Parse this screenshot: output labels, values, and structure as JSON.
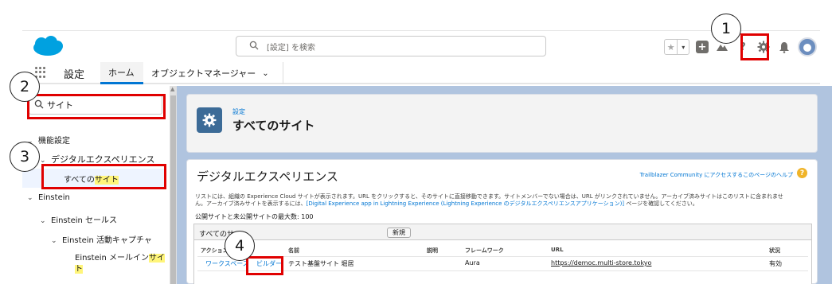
{
  "header": {
    "search_placeholder": "[設定] を検索"
  },
  "nav": {
    "app_name": "設定",
    "tabs": [
      {
        "label": "ホーム"
      },
      {
        "label": "オブジェクトマネージャー"
      }
    ]
  },
  "sidebar": {
    "search_value": "サイト",
    "tree": {
      "functional_settings": "機能設定",
      "digital_experience": "デジタルエクスペリエンス",
      "all_sites_prefix": "すべての",
      "all_sites_highlight": "サイト",
      "einstein": "Einstein",
      "einstein_sales": "Einstein セールス",
      "einstein_activity": "Einstein 活動キャプチャ",
      "einstein_mail_prefix": "Einstein メールイン",
      "einstein_mail_highlight": "サイ",
      "einstein_mail_highlight2": "ト"
    }
  },
  "page_header": {
    "kicker": "設定",
    "title": "すべてのサイト"
  },
  "card": {
    "title": "デジタルエクスペリエンス",
    "help_link": "Trailblazer Community にアクセスするこのページのヘルプ",
    "desc_line1": "リストには、組織の Experience Cloud サイトが表示されます。URL をクリックすると、そのサイトに直接移動できます。サイトメンバーでない場合は、URL がリンクされていません。アーカイブ済みサイトはこのリストに含まれませ",
    "desc_line2_a": "ん。アーカイブ済みサイトを表示するには、",
    "desc_line2_link": "[Digital Experience app in Lightning Experience (Lightning Experience のデジタルエクスペリエンスアプリケーション)]",
    "desc_line2_b": " ページを確認してください。",
    "max_sites": "公開サイトと未公開サイトの最大数: 100",
    "list_label": "すべてのサ",
    "new_button": "新規",
    "columns": [
      "アクション",
      "名前",
      "説明",
      "フレームワーク",
      "URL",
      "状況"
    ],
    "rows": [
      {
        "action_workspace": "ワークスペース",
        "action_builder": "ビルダー",
        "name": "テスト基盤サイト 堀居",
        "description": "",
        "framework": "Aura",
        "url": "https://democ.multi-store.tokyo",
        "status": "有効"
      }
    ]
  },
  "annotations": {
    "step1": "1",
    "step2": "2",
    "step3": "3",
    "step4": "4"
  },
  "colors": {
    "brand_blue": "#0176d3",
    "highlight_red": "#e00000",
    "setup_tile": "#3c6b97",
    "background_blue": "#b0c4df"
  }
}
